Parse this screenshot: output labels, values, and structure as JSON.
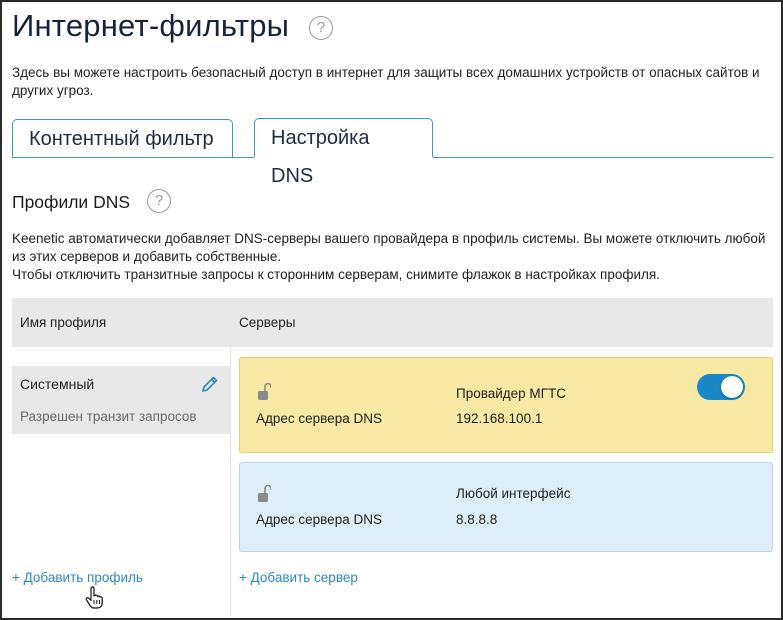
{
  "page": {
    "title": "Интернет-фильтры",
    "intro": "Здесь вы можете настроить безопасный доступ в интернет для защиты всех домашних устройств от опасных сайтов и других угроз."
  },
  "tabs": [
    {
      "label": "Контентный фильтр",
      "active": false
    },
    {
      "label": "Настройка DNS",
      "active": true
    }
  ],
  "dns_section": {
    "title": "Профили DNS",
    "description_line1": "Keenetic автоматически добавляет DNS-серверы вашего провайдера в профиль системы. Вы можете отключить любой из этих серверов и добавить собственные.",
    "description_line2": "Чтобы отключить транзитные запросы к сторонним серверам, снимите флажок в настройках профиля."
  },
  "table": {
    "col_profile": "Имя профиля",
    "col_servers": "Серверы"
  },
  "profiles": [
    {
      "name": "Системный",
      "status": "Разрешен транзит запросов"
    }
  ],
  "servers": [
    {
      "label": "Адрес сервера DNS",
      "name": "Провайдер МГТС",
      "address": "192.168.100.1",
      "enabled": true,
      "color": "#f7e9a3"
    },
    {
      "label": "Адрес сервера DNS",
      "name": "Любой интерфейс",
      "address": "8.8.8.8",
      "color": "#deeef8"
    }
  ],
  "actions": {
    "add_profile": "+ Добавить профиль",
    "add_server": "+ Добавить сервер"
  },
  "help_glyph": "?",
  "colors": {
    "accent": "#1a87c6",
    "link": "#2a8ac4",
    "tab_border": "#3f9ac8"
  }
}
